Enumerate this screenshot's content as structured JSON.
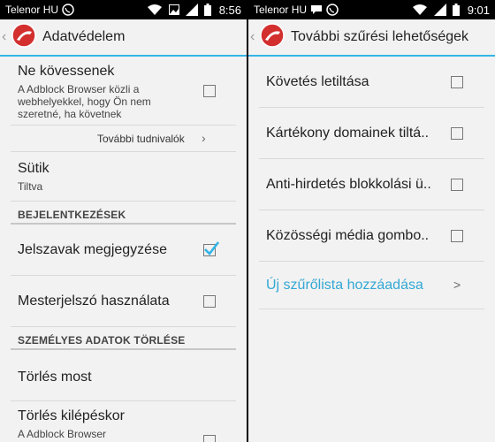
{
  "left": {
    "status": {
      "carrier": "Telenor HU",
      "time": "8:56"
    },
    "title": "Adatvédelem",
    "dnt": {
      "label": "Ne kövessenek",
      "sub_line1": "A Adblock Browser közli a",
      "sub_line2": "webhelyekkel, hogy Ön nem",
      "sub_line3": "szeretné, ha követnek",
      "checked": false
    },
    "more_info": "További tudnivalók",
    "cookies": {
      "label": "Sütik",
      "value": "Tiltva"
    },
    "section_login": "BEJELENTKEZÉSEK",
    "remember_passwords": {
      "label": "Jelszavak megjegyzése",
      "checked": true
    },
    "master_password": {
      "label": "Mesterjelszó használata",
      "checked": false
    },
    "section_clear": "SZEMÉLYES ADATOK TÖRLÉSE",
    "clear_now": "Törlés most",
    "clear_on_exit": {
      "label": "Törlés kilépéskor",
      "sub": "A Adblock Browser",
      "checked": false
    }
  },
  "right": {
    "status": {
      "carrier": "Telenor HU",
      "time": "9:01"
    },
    "title": "További szűrési lehetőségek",
    "items": [
      {
        "label": "Követés letiltása",
        "checked": false
      },
      {
        "label": "Kártékony domainek tiltá..",
        "checked": false
      },
      {
        "label": "Anti-hirdetés blokkolási ü..",
        "checked": false
      },
      {
        "label": "Közösségi média gombo..",
        "checked": false
      }
    ],
    "add_list": "Új szűrőlista hozzáadása"
  },
  "colors": {
    "accent": "#33b5e5",
    "link": "#33a8d4",
    "background": "#f2f2f2"
  }
}
